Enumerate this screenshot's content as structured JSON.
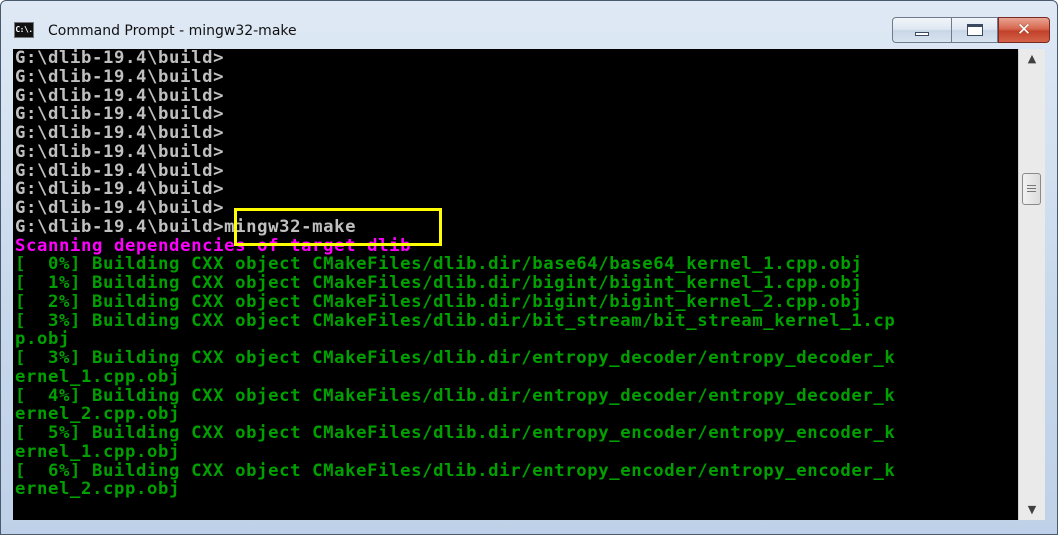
{
  "window": {
    "title": "Command Prompt - mingw32-make",
    "icon_text": "C:\\."
  },
  "caption_buttons": {
    "minimize": "minimize",
    "maximize": "maximize",
    "close": "close"
  },
  "colors": {
    "console_bg": "#000000",
    "prompt_text": "#c0c0c0",
    "scanning_text": "#ff00ff",
    "build_text": "#00a000",
    "highlight": "#ffff00"
  },
  "console": {
    "lines": [
      {
        "text": "G:\\dlib-19.4\\build>",
        "color": "gray"
      },
      {
        "text": "G:\\dlib-19.4\\build>",
        "color": "gray"
      },
      {
        "text": "G:\\dlib-19.4\\build>",
        "color": "gray"
      },
      {
        "text": "G:\\dlib-19.4\\build>",
        "color": "gray"
      },
      {
        "text": "G:\\dlib-19.4\\build>",
        "color": "gray"
      },
      {
        "text": "G:\\dlib-19.4\\build>",
        "color": "gray"
      },
      {
        "text": "G:\\dlib-19.4\\build>",
        "color": "gray"
      },
      {
        "text": "G:\\dlib-19.4\\build>",
        "color": "gray"
      },
      {
        "text": "G:\\dlib-19.4\\build>",
        "color": "gray"
      },
      {
        "text": "G:\\dlib-19.4\\build>mingw32-make",
        "color": "gray"
      },
      {
        "text": "Scanning dependencies of target dlib",
        "color": "magenta"
      },
      {
        "text": "[  0%] Building CXX object CMakeFiles/dlib.dir/base64/base64_kernel_1.cpp.obj",
        "color": "green"
      },
      {
        "text": "[  1%] Building CXX object CMakeFiles/dlib.dir/bigint/bigint_kernel_1.cpp.obj",
        "color": "green"
      },
      {
        "text": "[  2%] Building CXX object CMakeFiles/dlib.dir/bigint/bigint_kernel_2.cpp.obj",
        "color": "green"
      },
      {
        "text": "[  3%] Building CXX object CMakeFiles/dlib.dir/bit_stream/bit_stream_kernel_1.cp",
        "color": "green"
      },
      {
        "text": "p.obj",
        "color": "green"
      },
      {
        "text": "[  3%] Building CXX object CMakeFiles/dlib.dir/entropy_decoder/entropy_decoder_k",
        "color": "green"
      },
      {
        "text": "ernel_1.cpp.obj",
        "color": "green"
      },
      {
        "text": "[  4%] Building CXX object CMakeFiles/dlib.dir/entropy_decoder/entropy_decoder_k",
        "color": "green"
      },
      {
        "text": "ernel_2.cpp.obj",
        "color": "green"
      },
      {
        "text": "[  5%] Building CXX object CMakeFiles/dlib.dir/entropy_encoder/entropy_encoder_k",
        "color": "green"
      },
      {
        "text": "ernel_1.cpp.obj",
        "color": "green"
      },
      {
        "text": "[  6%] Building CXX object CMakeFiles/dlib.dir/entropy_encoder/entropy_encoder_k",
        "color": "green"
      },
      {
        "text": "ernel_2.cpp.obj",
        "color": "green"
      }
    ],
    "highlighted_command": "mingw32-make"
  },
  "scrollbar": {
    "up_arrow": "▲",
    "down_arrow": "▼"
  }
}
